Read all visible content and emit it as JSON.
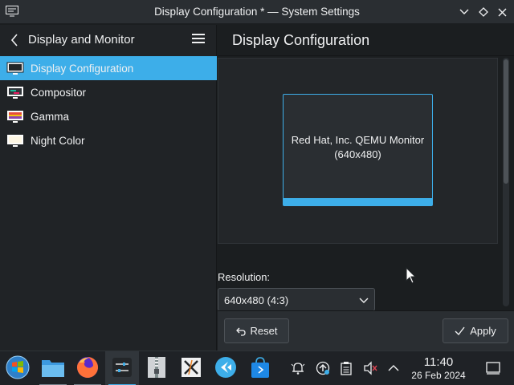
{
  "window": {
    "title": "Display Configuration * — System Settings"
  },
  "sidebar": {
    "header_title": "Display and Monitor",
    "items": [
      {
        "label": "Display Configuration",
        "icon": "display-icon",
        "active": true
      },
      {
        "label": "Compositor",
        "icon": "compositor-icon",
        "active": false
      },
      {
        "label": "Gamma",
        "icon": "gamma-icon",
        "active": false
      },
      {
        "label": "Night Color",
        "icon": "night-color-icon",
        "active": false
      }
    ]
  },
  "main": {
    "page_title": "Display Configuration",
    "monitor": {
      "name": "Red Hat, Inc. QEMU Monitor",
      "resolution_label": "(640x480)"
    },
    "resolution": {
      "label": "Resolution:",
      "value": "640x480 (4:3)"
    },
    "footer": {
      "reset_label": "Reset",
      "apply_label": "Apply"
    }
  },
  "taskbar": {
    "apps": [
      {
        "name": "application-launcher",
        "running": false
      },
      {
        "name": "file-manager",
        "running": true
      },
      {
        "name": "firefox",
        "running": true
      },
      {
        "name": "system-settings",
        "running": true,
        "active": true
      },
      {
        "name": "archive-manager",
        "running": false
      },
      {
        "name": "x-tool",
        "running": false
      },
      {
        "name": "kde-connect",
        "running": false
      },
      {
        "name": "discover-store",
        "running": false
      }
    ],
    "clock": {
      "time": "11:40",
      "date": "26 Feb 2024"
    }
  },
  "colors": {
    "accent": "#3daee9",
    "background": "#1b1e20",
    "sidebar": "#202326",
    "text": "#eff0f1"
  }
}
